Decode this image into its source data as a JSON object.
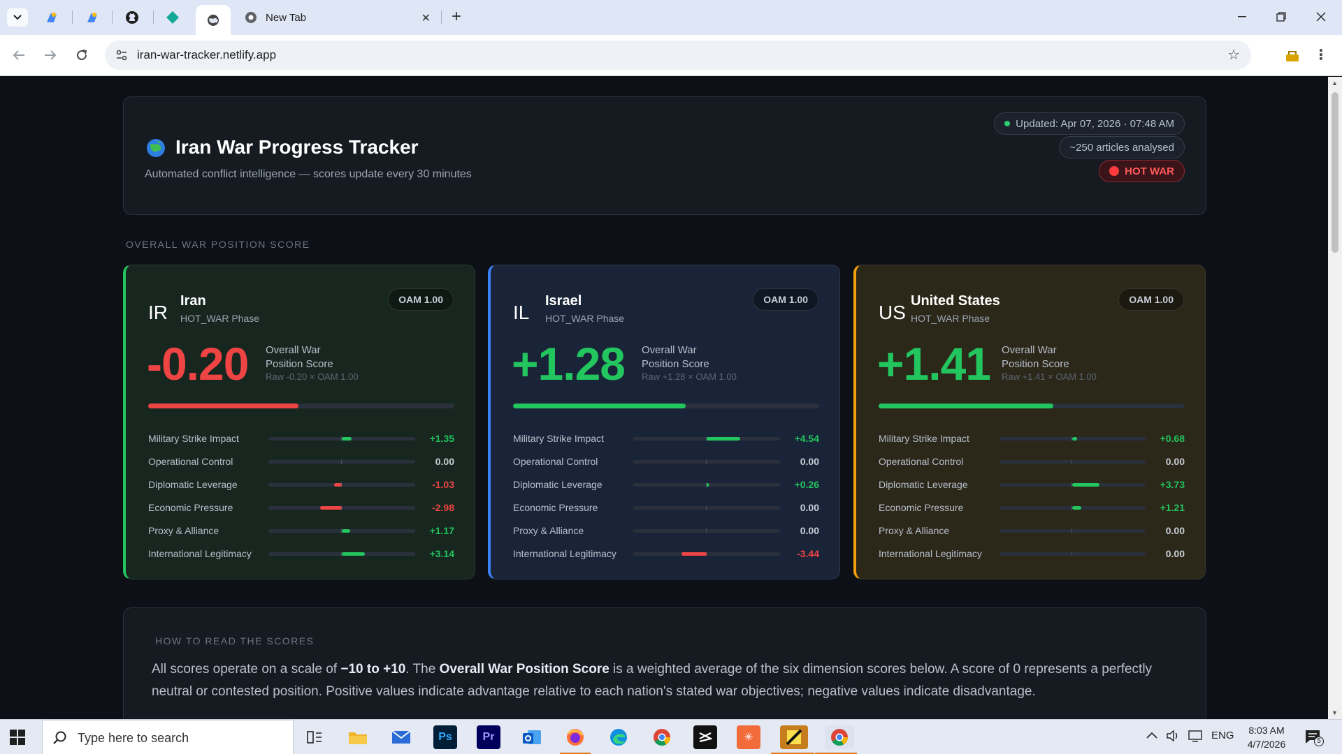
{
  "browser": {
    "tabs": [
      {
        "label": "New Tab"
      }
    ],
    "url": "iran-war-tracker.netlify.app"
  },
  "header": {
    "title": "Iran War Progress Tracker",
    "subtitle": "Automated conflict intelligence — scores update every 30 minutes",
    "updated": "Updated: Apr 07, 2026 · 07:48 AM",
    "articles": "~250 articles analysed",
    "status": "HOT WAR"
  },
  "section_label": "OVERALL WAR POSITION SCORE",
  "countries": [
    {
      "abbr": "IR",
      "name": "Iran",
      "phase": "HOT_WAR Phase",
      "oam": "OAM 1.00",
      "score": "-0.20",
      "score_label_1": "Overall War",
      "score_label_2": "Position Score",
      "raw": "Raw -0.20 × OAM 1.00",
      "bar_fraction": 0.49,
      "accent": "#22c55e",
      "bg": "#17271f",
      "score_color": "#ef4444",
      "dimensions": [
        {
          "label": "Military Strike Impact",
          "value": "+1.35",
          "num": 1.35
        },
        {
          "label": "Operational Control",
          "value": "0.00",
          "num": 0
        },
        {
          "label": "Diplomatic Leverage",
          "value": "-1.03",
          "num": -1.03
        },
        {
          "label": "Economic Pressure",
          "value": "-2.98",
          "num": -2.98
        },
        {
          "label": "Proxy & Alliance",
          "value": "+1.17",
          "num": 1.17
        },
        {
          "label": "International Legitimacy",
          "value": "+3.14",
          "num": 3.14
        }
      ]
    },
    {
      "abbr": "IL",
      "name": "Israel",
      "phase": "HOT_WAR Phase",
      "oam": "OAM 1.00",
      "score": "+1.28",
      "score_label_1": "Overall War",
      "score_label_2": "Position Score",
      "raw": "Raw +1.28 × OAM 1.00",
      "bar_fraction": 0.564,
      "accent": "#3b82f6",
      "bg": "#1a2438",
      "score_color": "#22c55e",
      "dimensions": [
        {
          "label": "Military Strike Impact",
          "value": "+4.54",
          "num": 4.54
        },
        {
          "label": "Operational Control",
          "value": "0.00",
          "num": 0
        },
        {
          "label": "Diplomatic Leverage",
          "value": "+0.26",
          "num": 0.26
        },
        {
          "label": "Economic Pressure",
          "value": "0.00",
          "num": 0
        },
        {
          "label": "Proxy & Alliance",
          "value": "0.00",
          "num": 0
        },
        {
          "label": "International Legitimacy",
          "value": "-3.44",
          "num": -3.44
        }
      ]
    },
    {
      "abbr": "US",
      "name": "United States",
      "phase": "HOT_WAR Phase",
      "oam": "OAM 1.00",
      "score": "+1.41",
      "score_label_1": "Overall War",
      "score_label_2": "Position Score",
      "raw": "Raw +1.41 × OAM 1.00",
      "bar_fraction": 0.57,
      "accent": "#f59e0b",
      "bg": "#2b2719",
      "score_color": "#22c55e",
      "dimensions": [
        {
          "label": "Military Strike Impact",
          "value": "+0.68",
          "num": 0.68
        },
        {
          "label": "Operational Control",
          "value": "0.00",
          "num": 0
        },
        {
          "label": "Diplomatic Leverage",
          "value": "+3.73",
          "num": 3.73
        },
        {
          "label": "Economic Pressure",
          "value": "+1.21",
          "num": 1.21
        },
        {
          "label": "Proxy & Alliance",
          "value": "0.00",
          "num": 0
        },
        {
          "label": "International Legitimacy",
          "value": "0.00",
          "num": 0
        }
      ]
    }
  ],
  "help": {
    "title": "HOW TO READ THE SCORES",
    "p1": "All scores operate on a scale of ",
    "range": "−10 to +10",
    "p2": ". The ",
    "term": "Overall War Position Score",
    "p3": " is a weighted average of the six dimension scores below. A score of 0 represents a perfectly neutral or contested position. Positive values indicate advantage relative to each nation's stated war objectives; negative values indicate disadvantage."
  },
  "taskbar": {
    "search_placeholder": "Type here to search",
    "language": "ENG",
    "time": "8:03 AM",
    "date": "4/7/2026",
    "notifications": "5"
  },
  "colors": {
    "positive": "#22c55e",
    "negative": "#ef4444",
    "neutral": "#c8ced6"
  }
}
